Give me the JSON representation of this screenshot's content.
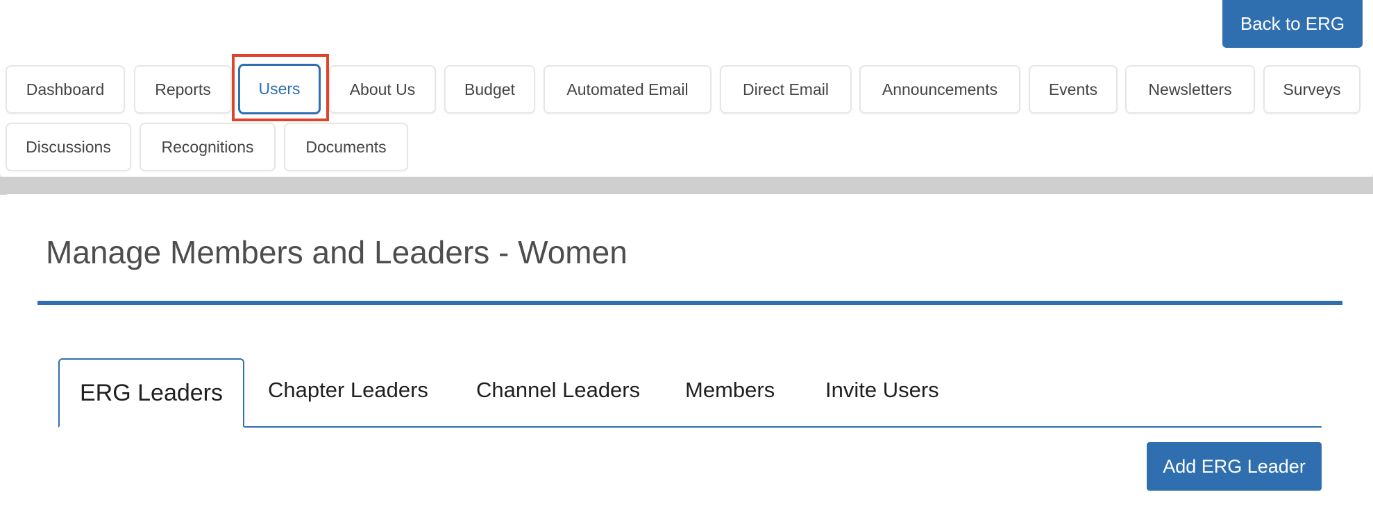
{
  "header": {
    "back_label": "Back to ERG"
  },
  "nav": {
    "tabs": [
      {
        "label": "Dashboard"
      },
      {
        "label": "Reports"
      },
      {
        "label": "Users",
        "active": true
      },
      {
        "label": "About Us"
      },
      {
        "label": "Budget"
      },
      {
        "label": "Automated Email"
      },
      {
        "label": "Direct Email"
      },
      {
        "label": "Announcements"
      },
      {
        "label": "Events"
      },
      {
        "label": "Newsletters"
      },
      {
        "label": "Surveys"
      },
      {
        "label": "Discussions"
      },
      {
        "label": "Recognitions"
      },
      {
        "label": "Documents"
      }
    ]
  },
  "main": {
    "title": "Manage Members and Leaders - Women",
    "sub_tabs": [
      {
        "label": "ERG Leaders",
        "active": true
      },
      {
        "label": "Chapter Leaders"
      },
      {
        "label": "Channel Leaders"
      },
      {
        "label": "Members"
      },
      {
        "label": "Invite Users"
      }
    ],
    "add_button_label": "Add ERG Leader"
  },
  "colors": {
    "accent": "#2f6fb0",
    "highlight": "#e0432c"
  }
}
